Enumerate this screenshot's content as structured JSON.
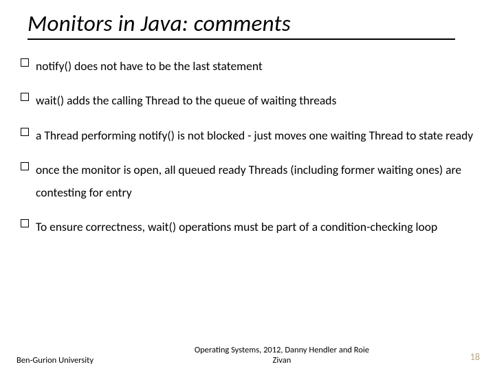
{
  "slide": {
    "title": "Monitors  in Java: comments",
    "bullets": [
      "notify()  does not have to be the last statement",
      "wait()  adds the calling Thread to the queue of waiting threads",
      "a Thread performing notify() is not blocked - just moves one waiting Thread to state ready",
      "once the monitor is open, all queued ready Threads (including former waiting ones) are contesting for entry",
      "To ensure correctness, wait() operations must be part of a condition-checking loop"
    ],
    "footer": {
      "left": "Ben-Gurion University",
      "center_line1": "Operating Systems, 2012, Danny Hendler and Roie",
      "center_line2": "Zivan",
      "page_number": "18"
    }
  }
}
